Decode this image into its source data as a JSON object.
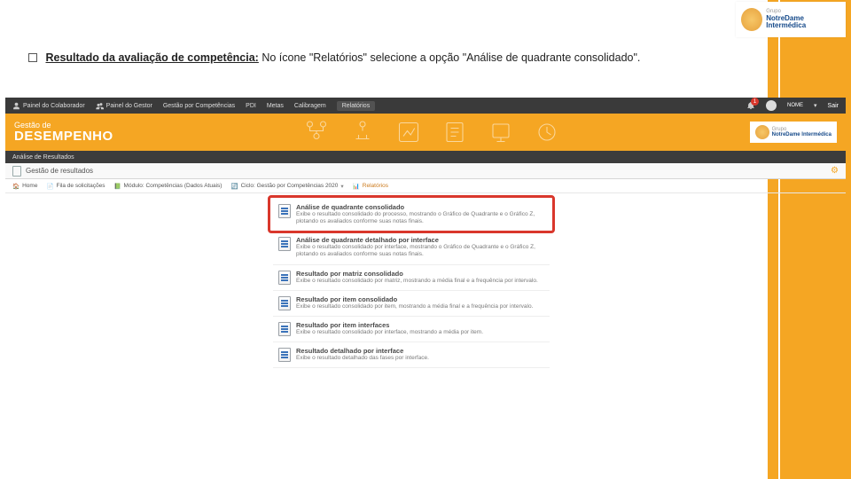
{
  "instruction": {
    "lead": "Resultado da avaliação de competência:",
    "rest": " No ícone \"Relatórios\" selecione a opção \"Análise de quadrante consolidado\"."
  },
  "topLogo": {
    "group": "Grupo",
    "brand": "NotreDame Intermédica"
  },
  "menubar": {
    "items": [
      "Painel do Colaborador",
      "Painel do Gestor",
      "Gestão por Competências",
      "PDI",
      "Metas",
      "Calibragem",
      "Relatórios"
    ],
    "selected": "Relatórios",
    "badge": "1",
    "user": "NOME",
    "logout": "Sair"
  },
  "banner": {
    "sup": "Gestão de",
    "main": "DESEMPENHO",
    "logo_group": "Grupo",
    "logo_brand": "NotreDame Intermédica"
  },
  "subbar": "Análise de Resultados",
  "section": {
    "title": "Gestão de resultados"
  },
  "crumbs": {
    "home": "Home",
    "fila": "Fila de solicitações",
    "modulo": "Módulo: Competências (Dados Atuais)",
    "ciclo": "Ciclo: Gestão por Competências 2020",
    "relatorios": "Relatórios"
  },
  "reports": [
    {
      "t": "Análise de quadrante consolidado",
      "d": "Exibe o resultado consolidado do processo, mostrando o Gráfico de Quadrante e o Gráfico Z, plotando os avaliados conforme suas notas finais."
    },
    {
      "t": "Análise de quadrante detalhado por interface",
      "d": "Exibe o resultado consolidado por interface, mostrando o Gráfico de Quadrante e o Gráfico Z, plotando os avaliados conforme suas notas finais."
    },
    {
      "t": "Resultado por matriz consolidado",
      "d": "Exibe o resultado consolidado por matriz, mostrando a média final e a frequência por intervalo."
    },
    {
      "t": "Resultado por item consolidado",
      "d": "Exibe o resultado consolidado por item, mostrando a média final e a frequência por intervalo."
    },
    {
      "t": "Resultado por item interfaces",
      "d": "Exibe o resultado consolidado por interface, mostrando a média por item."
    },
    {
      "t": "Resultado detalhado por interface",
      "d": "Exibe o resultado detalhado das fases por interface."
    }
  ]
}
